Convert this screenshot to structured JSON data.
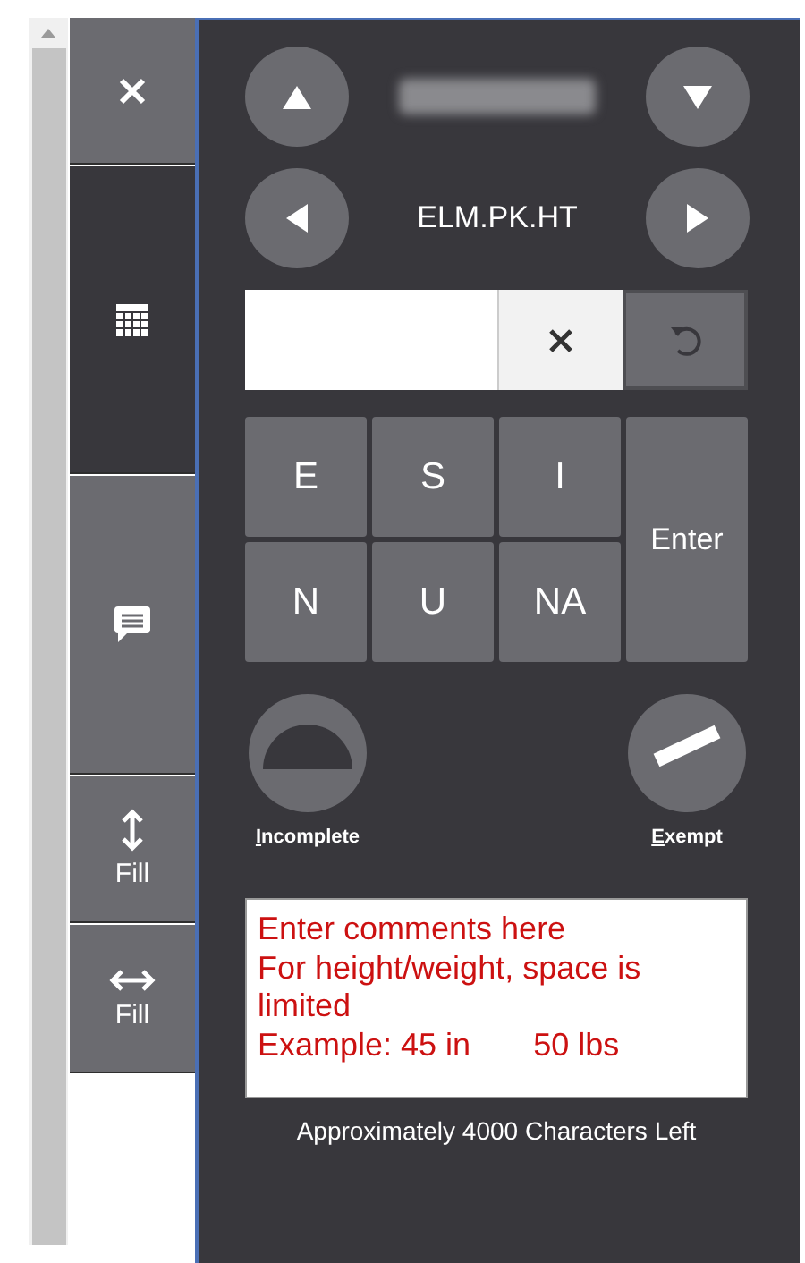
{
  "sidebar": {
    "items": [
      {
        "kind": "close",
        "selected": false
      },
      {
        "kind": "grid",
        "selected": true
      },
      {
        "kind": "comment",
        "selected": false
      },
      {
        "kind": "fill-vertical",
        "label": "Fill",
        "selected": false
      },
      {
        "kind": "fill-horizontal",
        "label": "Fill",
        "selected": false
      }
    ]
  },
  "navigator": {
    "field_code": "ELM.PK.HT"
  },
  "keypad": [
    {
      "kind": "key",
      "label": "E"
    },
    {
      "kind": "key",
      "label": "S"
    },
    {
      "kind": "key",
      "label": "I"
    },
    {
      "kind": "enter",
      "label": "Enter"
    },
    {
      "kind": "key",
      "label": "N"
    },
    {
      "kind": "key",
      "label": "U"
    },
    {
      "kind": "key",
      "label": "NA"
    }
  ],
  "status_buttons": [
    {
      "kind": "incomplete",
      "label": "Incomplete"
    },
    {
      "kind": "exempt",
      "label": "Exempt"
    }
  ],
  "comments": {
    "placeholder_lines": [
      "Enter comments here",
      "For height/weight, space is limited",
      "Example: 45 in       50 lbs"
    ],
    "counter": "Approximately 4000 Characters Left"
  }
}
